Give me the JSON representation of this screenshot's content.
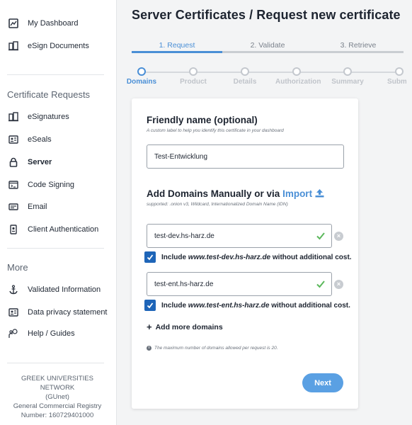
{
  "sidebar": {
    "top_items": [
      {
        "label": "My Dashboard",
        "icon": "dashboard-icon"
      },
      {
        "label": "eSign Documents",
        "icon": "esign-icon"
      }
    ],
    "section1_title": "Certificate Requests",
    "cert_items": [
      {
        "label": "eSignatures",
        "icon": "esignature-icon"
      },
      {
        "label": "eSeals",
        "icon": "eseal-icon"
      },
      {
        "label": "Server",
        "icon": "lock-icon",
        "active": true
      },
      {
        "label": "Code Signing",
        "icon": "code-icon"
      },
      {
        "label": "Email",
        "icon": "email-icon"
      },
      {
        "label": "Client Authentication",
        "icon": "client-auth-icon"
      }
    ],
    "section2_title": "More",
    "more_items": [
      {
        "label": "Validated Information",
        "icon": "anchor-icon"
      },
      {
        "label": "Data privacy statement",
        "icon": "id-card-icon"
      },
      {
        "label": "Help / Guides",
        "icon": "help-icon"
      }
    ],
    "footer": {
      "line1": "GREEK UNIVERSITIES NETWORK",
      "line2": "(GUnet)",
      "line3": "General Commercial Registry",
      "line4": "Number: 160729401000"
    }
  },
  "page_title": "Server Certificates / Request new certificate",
  "tabs": [
    {
      "label": "1. Request",
      "active": true
    },
    {
      "label": "2. Validate",
      "active": false
    },
    {
      "label": "3. Retrieve",
      "active": false
    }
  ],
  "steps": [
    {
      "label": "Domains",
      "active": true
    },
    {
      "label": "Product",
      "active": false
    },
    {
      "label": "Details",
      "active": false
    },
    {
      "label": "Authorization",
      "active": false
    },
    {
      "label": "Summary",
      "active": false
    },
    {
      "label": "Submit",
      "active": false
    }
  ],
  "form": {
    "friendly_title": "Friendly name (optional)",
    "friendly_hint": "A custom label to help you identify this certificate in your dashboard",
    "friendly_value": "Test-Entwicklung",
    "domains_title": "Add Domains Manually or via",
    "import_label": "Import",
    "domains_hint": "supported: .onion v3, Wildcard, Internationalized Domain Name (IDN)",
    "domains": [
      {
        "value": "test-dev.hs-harz.de",
        "include_prefix": "Include",
        "include_domain": "www.test-dev.hs-harz.de",
        "include_suffix": "without additional cost."
      },
      {
        "value": "test-ent.hs-harz.de",
        "include_prefix": "Include",
        "include_domain": "www.test-ent.hs-harz.de",
        "include_suffix": "without additional cost."
      }
    ],
    "add_more_label": "Add more domains",
    "max_note": "The maximum number of domains allowed per request is 20.",
    "next_label": "Next"
  },
  "colors": {
    "accent": "#4a8fd6",
    "checkbox": "#1e65b8",
    "valid": "#5cb85c",
    "next_button": "#5aa0e3"
  }
}
